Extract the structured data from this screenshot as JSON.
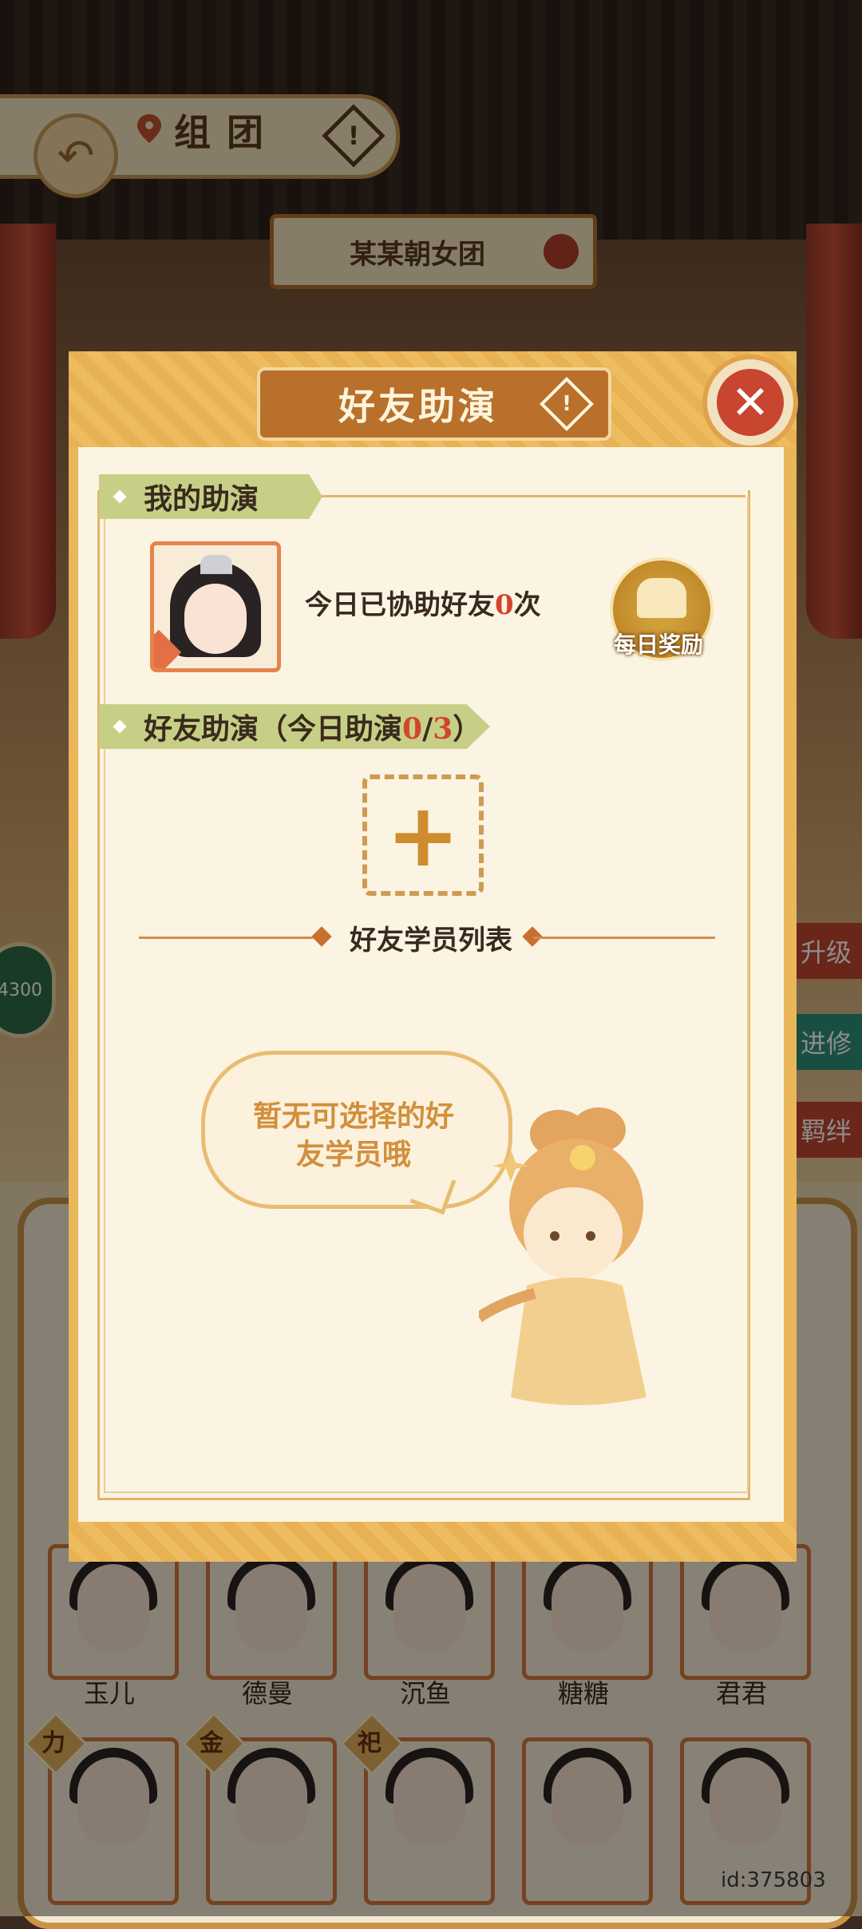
{
  "topbar": {
    "title": "组团"
  },
  "team": {
    "name": "某某朝女团"
  },
  "side_buttons": [
    "升级",
    "进修",
    "羁绊"
  ],
  "left_badge": "4300",
  "roster": {
    "row1": [
      "玉儿",
      "德曼",
      "沉鱼",
      "糖糖",
      "君君"
    ],
    "row2_tags": [
      "力",
      "金",
      "祀"
    ]
  },
  "id_label": "id:375803",
  "modal": {
    "title": "好友助演",
    "my_section": "我的助演",
    "assist_prefix": "今日已协助好友",
    "assist_count": "0",
    "assist_suffix": "次",
    "reward_label": "每日奖励",
    "friend_section_prefix": "好友助演（今日助演",
    "friend_used": "0",
    "friend_sep": "/",
    "friend_max": "3",
    "friend_section_suffix": "）",
    "list_title": "好友学员列表",
    "empty_line1": "暂无可选择的好",
    "empty_line2": "友学员哦"
  },
  "colors": {
    "accent_red": "#d2452d",
    "frame_gold": "#e9b659",
    "section_green": "#c7cf86"
  }
}
